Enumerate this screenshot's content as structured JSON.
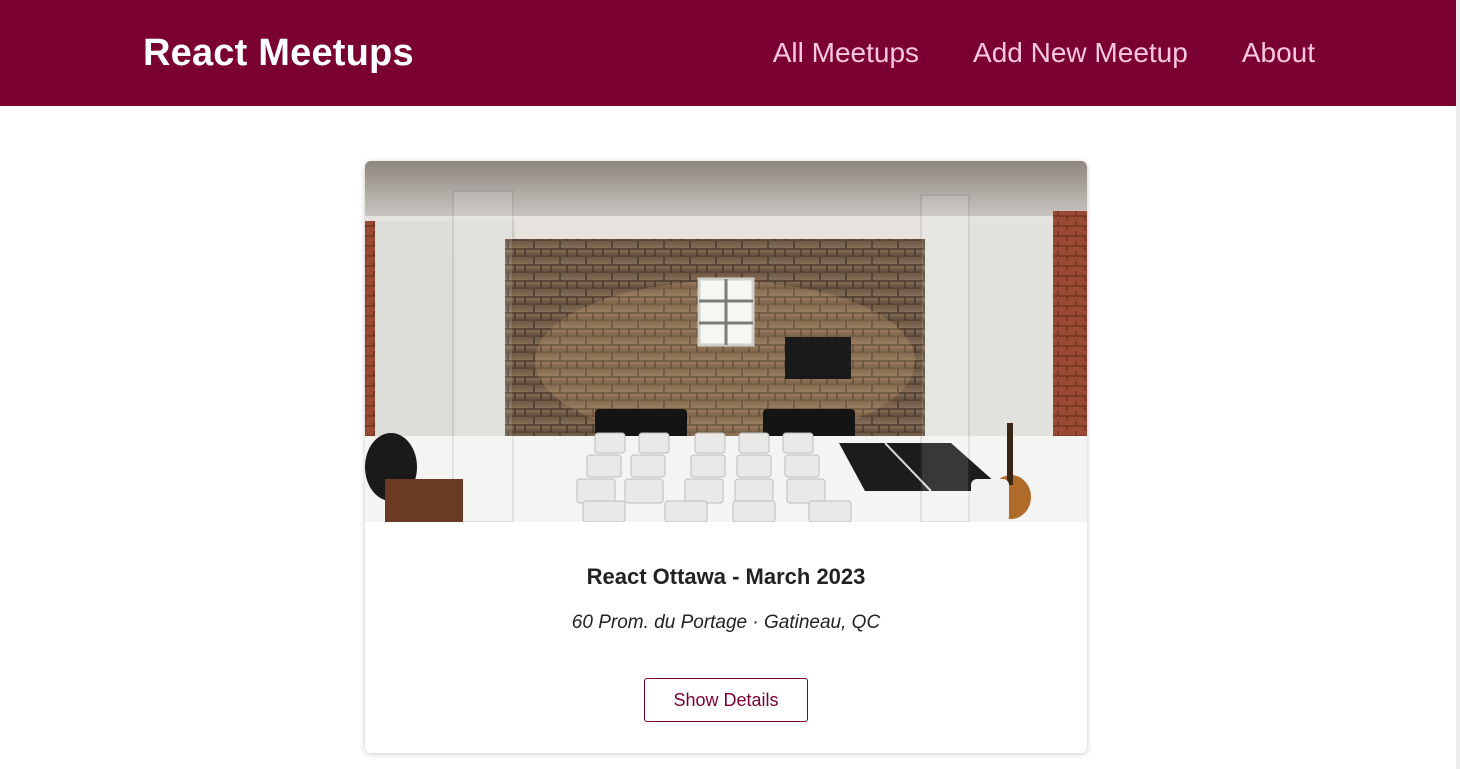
{
  "header": {
    "logo": "React Meetups",
    "nav": [
      {
        "label": "All Meetups"
      },
      {
        "label": "Add New Meetup"
      },
      {
        "label": "About"
      }
    ]
  },
  "meetup": {
    "title": "React Ottawa - March 2023",
    "address": "60 Prom. du Portage · Gatineau, QC",
    "details_label": "Show Details"
  },
  "colors": {
    "header_bg": "#7a0030",
    "nav_link": "#fcc7e0",
    "button_accent": "#7a0030"
  }
}
